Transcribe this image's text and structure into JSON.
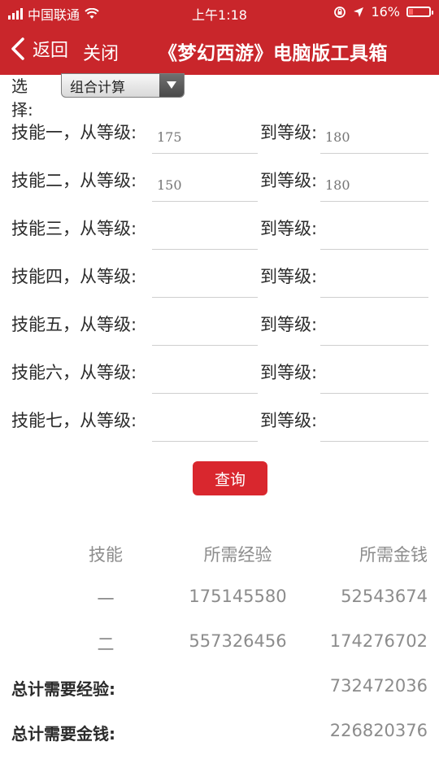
{
  "status": {
    "carrier": "中国联通",
    "time": "上午1:18",
    "battery": "16%",
    "battery_color": "#ff6060"
  },
  "nav": {
    "back_label": "返回",
    "close_label": "关闭",
    "title": "《梦幻西游》电脑版工具箱",
    "bg_color": "#c9262b"
  },
  "form": {
    "select_label": "选择:",
    "select_value": "组合计算",
    "rows": [
      {
        "from_label": "技能一，从等级:",
        "to_label": "到等级:",
        "from_value": "",
        "from_placeholder": "175",
        "to_value": "",
        "to_placeholder": "180"
      },
      {
        "from_label": "技能二，从等级:",
        "to_label": "到等级:",
        "from_value": "",
        "from_placeholder": "150",
        "to_value": "",
        "to_placeholder": "180"
      },
      {
        "from_label": "技能三，从等级:",
        "to_label": "到等级:",
        "from_value": "",
        "from_placeholder": "",
        "to_value": "",
        "to_placeholder": ""
      },
      {
        "from_label": "技能四，从等级:",
        "to_label": "到等级:",
        "from_value": "",
        "from_placeholder": "",
        "to_value": "",
        "to_placeholder": ""
      },
      {
        "from_label": "技能五，从等级:",
        "to_label": "到等级:",
        "from_value": "",
        "from_placeholder": "",
        "to_value": "",
        "to_placeholder": ""
      },
      {
        "from_label": "技能六，从等级:",
        "to_label": "到等级:",
        "from_value": "",
        "from_placeholder": "",
        "to_value": "",
        "to_placeholder": ""
      },
      {
        "from_label": "技能七，从等级:",
        "to_label": "到等级:",
        "from_value": "",
        "from_placeholder": "",
        "to_value": "",
        "to_placeholder": ""
      }
    ],
    "query_label": "查询"
  },
  "results": {
    "headers": [
      "技能",
      "所需经验",
      "所需金钱"
    ],
    "rows": [
      {
        "skill": "一",
        "exp": "175145580",
        "money": "52543674"
      },
      {
        "skill": "二",
        "exp": "557326456",
        "money": "174276702"
      }
    ],
    "total_exp_label": "总计需要经验:",
    "total_exp": "732472036",
    "total_money_label": "总计需要金钱:",
    "total_money": "226820376"
  },
  "icons": {
    "back": "chevron-left-icon",
    "signal": "signal-icon",
    "wifi": "wifi-icon",
    "lock": "rotation-lock-icon",
    "location": "location-arrow-icon",
    "battery": "battery-icon"
  }
}
